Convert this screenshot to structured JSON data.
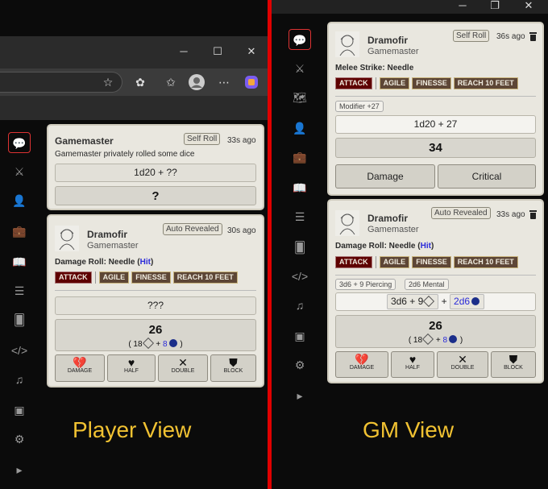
{
  "labels": {
    "player_view": "Player View",
    "gm_view": "GM View"
  },
  "colors": {
    "divider": "#e00000",
    "label": "#f1c232",
    "attack_trait": "#5e0000",
    "trait": "#5d4636",
    "hit": "#2a2ad9"
  },
  "window_controls": {
    "minimize": "─",
    "maximize": "☐",
    "close": "✕",
    "restore": "❐"
  },
  "browser_toolbar_icons": [
    "star-icon",
    "extensions-icon",
    "favorites-icon",
    "profile-icon",
    "more-icon",
    "copilot-icon"
  ],
  "sidebar_icons": [
    "chat-icon",
    "combat-icon",
    "scenes-icon",
    "actors-icon",
    "items-icon",
    "journal-icon",
    "tables-icon",
    "cards-icon",
    "macros-icon",
    "playlists-icon",
    "compendium-icon",
    "settings-icon",
    "expand-icon"
  ],
  "player": {
    "card1": {
      "speaker": "Gamemaster",
      "flag": "Self Roll",
      "time": "33s ago",
      "flavor": "Gamemaster privately rolled some dice",
      "formula": "1d20 + ??",
      "total": "?"
    },
    "card2": {
      "speaker": "Dramofir",
      "sub": "Gamemaster",
      "flag": "Auto Revealed",
      "time": "30s ago",
      "flavor_prefix": "Damage Roll: Needle (",
      "flavor_hit": "Hit",
      "flavor_suffix": ")",
      "traits": [
        "ATTACK",
        "AGILE",
        "FINESSE",
        "REACH 10 FEET"
      ],
      "formula": "???",
      "total": "26",
      "breakdown_open": "( 18",
      "breakdown_plus": "+",
      "breakdown_mental": "8",
      "breakdown_close": ")",
      "buttons": [
        "DAMAGE",
        "HALF",
        "DOUBLE",
        "BLOCK"
      ]
    }
  },
  "gm": {
    "card1": {
      "speaker": "Dramofir",
      "sub": "Gamemaster",
      "flag": "Self Roll",
      "time": "36s ago",
      "flavor": "Melee Strike: Needle",
      "traits": [
        "ATTACK",
        "AGILE",
        "FINESSE",
        "REACH 10 FEET"
      ],
      "modifier": "Modifier +27",
      "formula": "1d20 + 27",
      "total": "34",
      "buttons": [
        "Damage",
        "Critical"
      ]
    },
    "card2": {
      "speaker": "Dramofir",
      "sub": "Gamemaster",
      "flag": "Auto Revealed",
      "time": "33s ago",
      "flavor_prefix": "Damage Roll: Needle (",
      "flavor_hit": "Hit",
      "flavor_suffix": ")",
      "traits": [
        "ATTACK",
        "AGILE",
        "FINESSE",
        "REACH 10 FEET"
      ],
      "tags": [
        "3d6 + 9 Piercing",
        "2d6 Mental"
      ],
      "formula_piercing": "3d6 + 9",
      "formula_plus": "+",
      "formula_mental": "2d6",
      "total": "26",
      "breakdown_open": "( 18",
      "breakdown_plus": "+",
      "breakdown_mental": "8",
      "breakdown_close": ")",
      "buttons": [
        "DAMAGE",
        "HALF",
        "DOUBLE",
        "BLOCK"
      ]
    }
  }
}
